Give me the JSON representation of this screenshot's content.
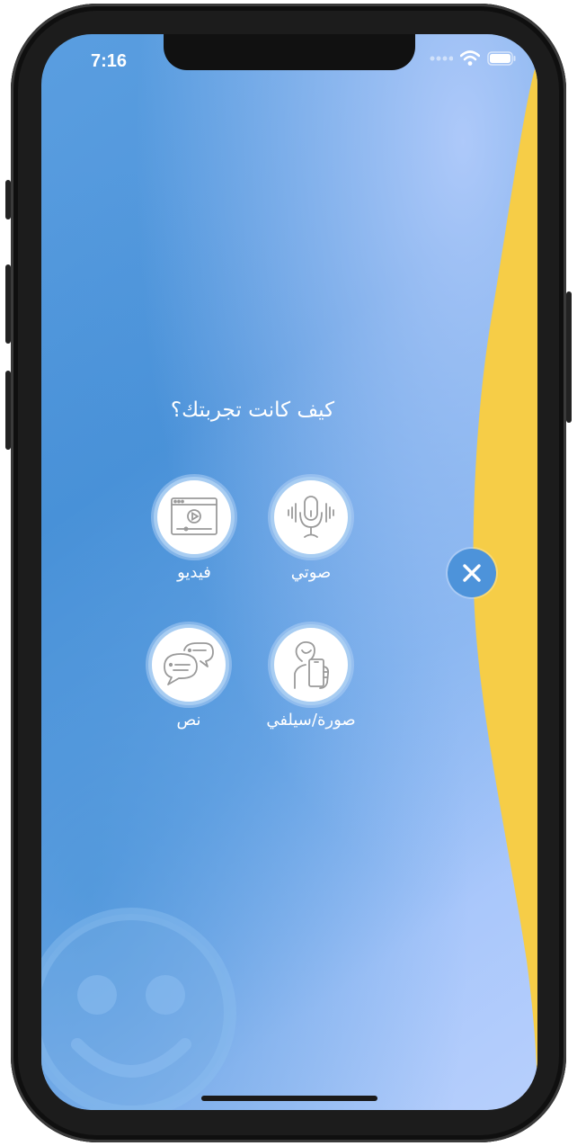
{
  "status_bar": {
    "time": "7:16",
    "icons": [
      "signal-dots-icon",
      "wifi-icon",
      "battery-icon"
    ]
  },
  "prompt": {
    "question": "كيف كانت تجربتك؟"
  },
  "options": [
    {
      "label": "صوتي",
      "icon": "microphone-icon"
    },
    {
      "label": "فيديو",
      "icon": "video-player-icon"
    },
    {
      "label": "صورة/سيلفي",
      "icon": "selfie-phone-icon"
    },
    {
      "label": "نص",
      "icon": "chat-bubbles-icon"
    }
  ],
  "close_button": {
    "icon": "close-icon"
  },
  "colors": {
    "background_blue": "#4d93da",
    "background_light": "#b7cffc",
    "accent_yellow": "#f6cd47",
    "circle_border": "#a8cdf2",
    "icon_gray": "#9a9a9a"
  }
}
